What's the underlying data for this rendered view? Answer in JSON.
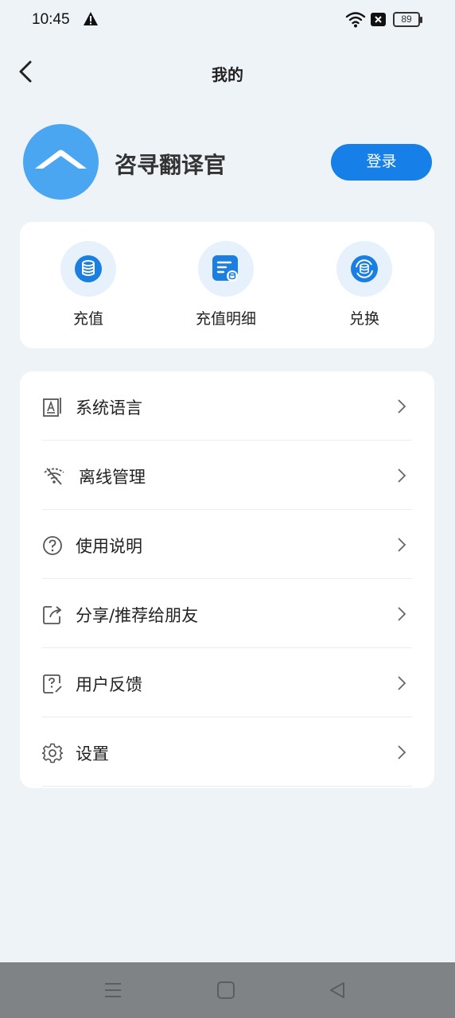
{
  "status": {
    "time": "10:45",
    "battery": "89"
  },
  "header": {
    "title": "我的"
  },
  "profile": {
    "name": "咨寻翻译官",
    "login_label": "登录"
  },
  "quick_actions": [
    {
      "label": "充值",
      "icon": "coin-stack-icon"
    },
    {
      "label": "充值明细",
      "icon": "recharge-detail-icon"
    },
    {
      "label": "兑换",
      "icon": "exchange-icon"
    }
  ],
  "menu": [
    {
      "label": "系统语言",
      "icon": "language-icon"
    },
    {
      "label": "离线管理",
      "icon": "offline-wifi-icon"
    },
    {
      "label": "使用说明",
      "icon": "help-icon"
    },
    {
      "label": "分享/推荐给朋友",
      "icon": "share-icon"
    },
    {
      "label": "用户反馈",
      "icon": "feedback-icon"
    },
    {
      "label": "设置",
      "icon": "gear-icon"
    }
  ],
  "colors": {
    "accent": "#1680e8",
    "avatar": "#4aa6f0",
    "background": "#eef3f8"
  }
}
